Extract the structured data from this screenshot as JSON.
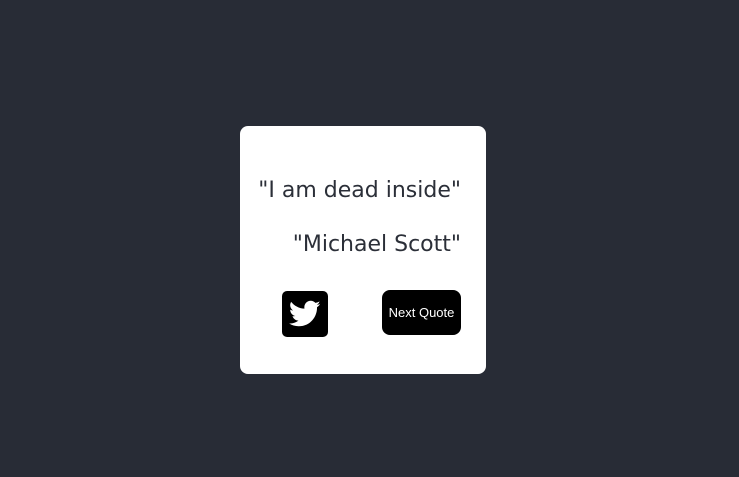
{
  "quote": {
    "text": "\"I am dead inside\"",
    "author": "\"Michael Scott\""
  },
  "actions": {
    "tweet_icon": "twitter-bird-icon",
    "next_label": "Next Quote"
  },
  "colors": {
    "background": "#282c36",
    "card": "#ffffff",
    "text": "#2b2f38",
    "button": "#000000",
    "button_text": "#ffffff"
  }
}
